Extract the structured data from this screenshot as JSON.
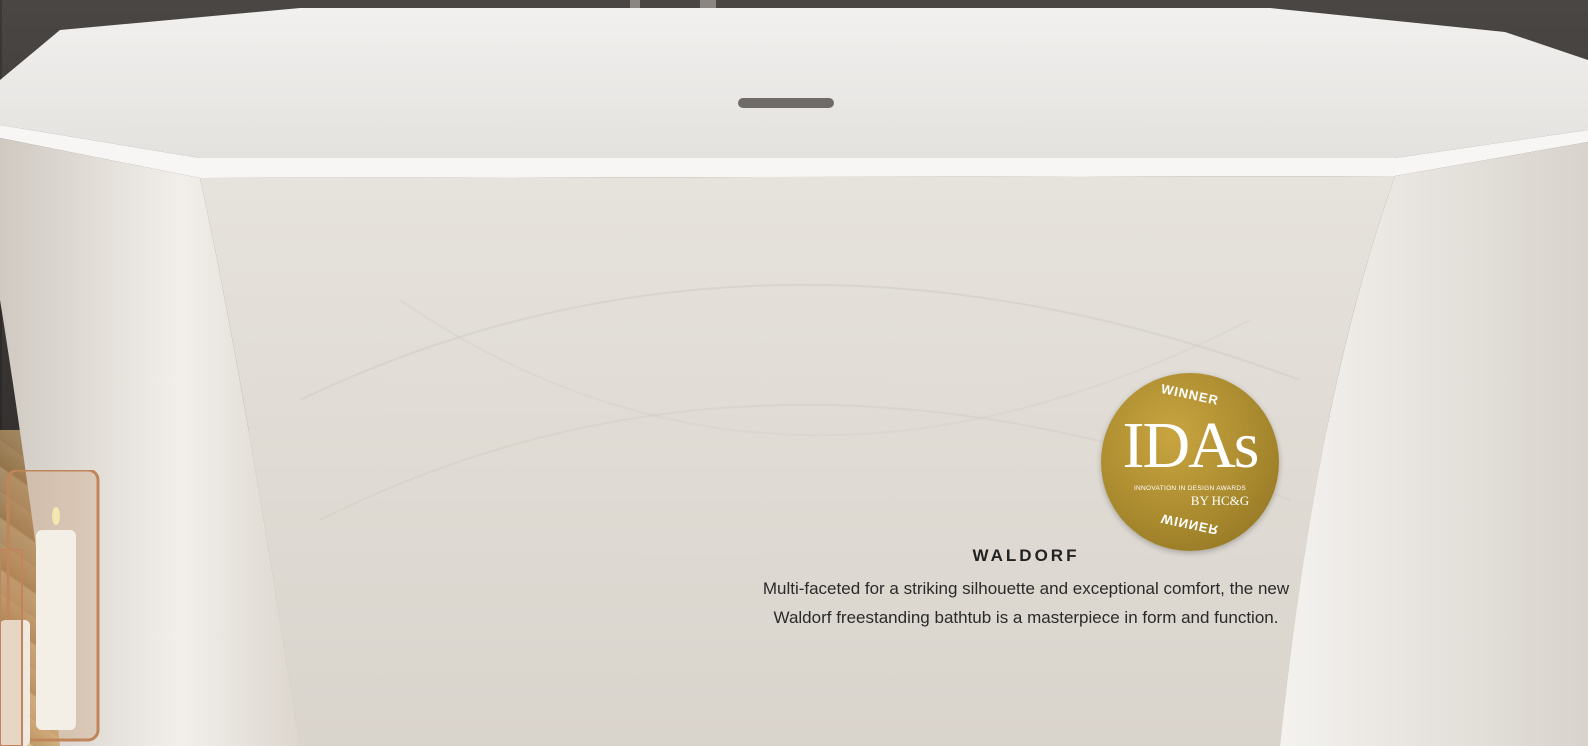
{
  "badge": {
    "top_text": "WINNER",
    "mark": "IDAs",
    "subtitle": "INNOVATION IN DESIGN AWARDS",
    "by": "BY HC&G",
    "bottom_text": "WINNER"
  },
  "product": {
    "title": "WALDORF",
    "description": "Multi-faceted for a striking silhouette and exceptional comfort, the new Waldorf freestanding bathtub is a masterpiece in form and function."
  },
  "colors": {
    "badge_gold": "#a98a2e",
    "tub_white": "#e9e6e2",
    "text_dark": "#222222"
  }
}
